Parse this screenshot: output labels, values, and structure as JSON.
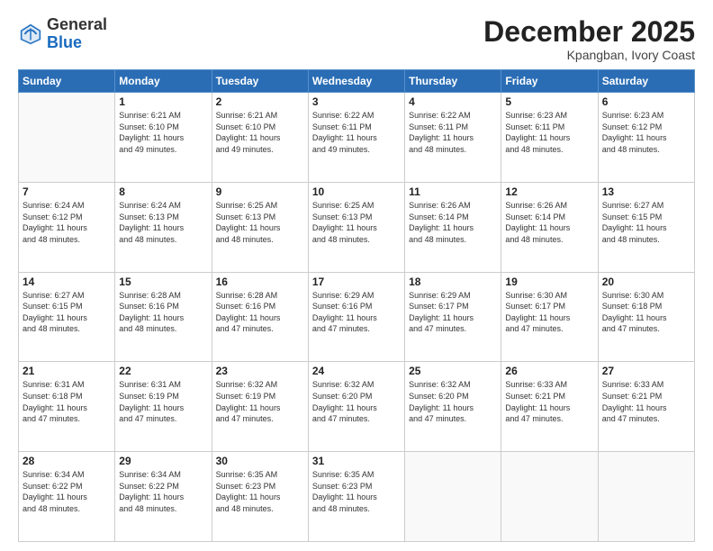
{
  "header": {
    "logo_general": "General",
    "logo_blue": "Blue",
    "month": "December 2025",
    "location": "Kpangban, Ivory Coast"
  },
  "weekdays": [
    "Sunday",
    "Monday",
    "Tuesday",
    "Wednesday",
    "Thursday",
    "Friday",
    "Saturday"
  ],
  "weeks": [
    [
      {
        "day": "",
        "info": ""
      },
      {
        "day": "1",
        "info": "Sunrise: 6:21 AM\nSunset: 6:10 PM\nDaylight: 11 hours\nand 49 minutes."
      },
      {
        "day": "2",
        "info": "Sunrise: 6:21 AM\nSunset: 6:10 PM\nDaylight: 11 hours\nand 49 minutes."
      },
      {
        "day": "3",
        "info": "Sunrise: 6:22 AM\nSunset: 6:11 PM\nDaylight: 11 hours\nand 49 minutes."
      },
      {
        "day": "4",
        "info": "Sunrise: 6:22 AM\nSunset: 6:11 PM\nDaylight: 11 hours\nand 48 minutes."
      },
      {
        "day": "5",
        "info": "Sunrise: 6:23 AM\nSunset: 6:11 PM\nDaylight: 11 hours\nand 48 minutes."
      },
      {
        "day": "6",
        "info": "Sunrise: 6:23 AM\nSunset: 6:12 PM\nDaylight: 11 hours\nand 48 minutes."
      }
    ],
    [
      {
        "day": "7",
        "info": "Sunrise: 6:24 AM\nSunset: 6:12 PM\nDaylight: 11 hours\nand 48 minutes."
      },
      {
        "day": "8",
        "info": "Sunrise: 6:24 AM\nSunset: 6:13 PM\nDaylight: 11 hours\nand 48 minutes."
      },
      {
        "day": "9",
        "info": "Sunrise: 6:25 AM\nSunset: 6:13 PM\nDaylight: 11 hours\nand 48 minutes."
      },
      {
        "day": "10",
        "info": "Sunrise: 6:25 AM\nSunset: 6:13 PM\nDaylight: 11 hours\nand 48 minutes."
      },
      {
        "day": "11",
        "info": "Sunrise: 6:26 AM\nSunset: 6:14 PM\nDaylight: 11 hours\nand 48 minutes."
      },
      {
        "day": "12",
        "info": "Sunrise: 6:26 AM\nSunset: 6:14 PM\nDaylight: 11 hours\nand 48 minutes."
      },
      {
        "day": "13",
        "info": "Sunrise: 6:27 AM\nSunset: 6:15 PM\nDaylight: 11 hours\nand 48 minutes."
      }
    ],
    [
      {
        "day": "14",
        "info": "Sunrise: 6:27 AM\nSunset: 6:15 PM\nDaylight: 11 hours\nand 48 minutes."
      },
      {
        "day": "15",
        "info": "Sunrise: 6:28 AM\nSunset: 6:16 PM\nDaylight: 11 hours\nand 48 minutes."
      },
      {
        "day": "16",
        "info": "Sunrise: 6:28 AM\nSunset: 6:16 PM\nDaylight: 11 hours\nand 47 minutes."
      },
      {
        "day": "17",
        "info": "Sunrise: 6:29 AM\nSunset: 6:16 PM\nDaylight: 11 hours\nand 47 minutes."
      },
      {
        "day": "18",
        "info": "Sunrise: 6:29 AM\nSunset: 6:17 PM\nDaylight: 11 hours\nand 47 minutes."
      },
      {
        "day": "19",
        "info": "Sunrise: 6:30 AM\nSunset: 6:17 PM\nDaylight: 11 hours\nand 47 minutes."
      },
      {
        "day": "20",
        "info": "Sunrise: 6:30 AM\nSunset: 6:18 PM\nDaylight: 11 hours\nand 47 minutes."
      }
    ],
    [
      {
        "day": "21",
        "info": "Sunrise: 6:31 AM\nSunset: 6:18 PM\nDaylight: 11 hours\nand 47 minutes."
      },
      {
        "day": "22",
        "info": "Sunrise: 6:31 AM\nSunset: 6:19 PM\nDaylight: 11 hours\nand 47 minutes."
      },
      {
        "day": "23",
        "info": "Sunrise: 6:32 AM\nSunset: 6:19 PM\nDaylight: 11 hours\nand 47 minutes."
      },
      {
        "day": "24",
        "info": "Sunrise: 6:32 AM\nSunset: 6:20 PM\nDaylight: 11 hours\nand 47 minutes."
      },
      {
        "day": "25",
        "info": "Sunrise: 6:32 AM\nSunset: 6:20 PM\nDaylight: 11 hours\nand 47 minutes."
      },
      {
        "day": "26",
        "info": "Sunrise: 6:33 AM\nSunset: 6:21 PM\nDaylight: 11 hours\nand 47 minutes."
      },
      {
        "day": "27",
        "info": "Sunrise: 6:33 AM\nSunset: 6:21 PM\nDaylight: 11 hours\nand 47 minutes."
      }
    ],
    [
      {
        "day": "28",
        "info": "Sunrise: 6:34 AM\nSunset: 6:22 PM\nDaylight: 11 hours\nand 48 minutes."
      },
      {
        "day": "29",
        "info": "Sunrise: 6:34 AM\nSunset: 6:22 PM\nDaylight: 11 hours\nand 48 minutes."
      },
      {
        "day": "30",
        "info": "Sunrise: 6:35 AM\nSunset: 6:23 PM\nDaylight: 11 hours\nand 48 minutes."
      },
      {
        "day": "31",
        "info": "Sunrise: 6:35 AM\nSunset: 6:23 PM\nDaylight: 11 hours\nand 48 minutes."
      },
      {
        "day": "",
        "info": ""
      },
      {
        "day": "",
        "info": ""
      },
      {
        "day": "",
        "info": ""
      }
    ]
  ]
}
